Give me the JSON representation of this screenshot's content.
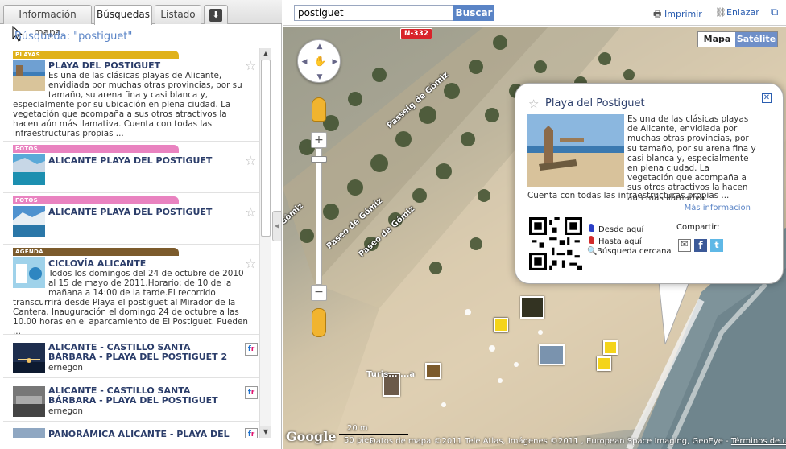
{
  "tabs": {
    "info": "Información mapa",
    "search": "Búsquedas",
    "list": "Listado"
  },
  "search_title": "Búsqueda: \"postiguet\"",
  "results": [
    {
      "category": "PLAYAS",
      "category_color": "#e0b21b",
      "title": "PLAYA DEL POSTIGUET",
      "desc": "Es una de las clásicas playas de Alicante, envidiada por muchas otras provincias, por su tamaño, su arena fina y casi blanca y,",
      "desc_full": "especialmente por su ubicación en plena ciudad. La vegetación que acompaña a sus otros atractivos la hacen aún más llamativa. Cuenta con todas las infraestructuras propias ..."
    },
    {
      "category": "FOTOS",
      "category_color": "#e983c0",
      "title": "ALICANTE PLAYA DEL POSTIGUET"
    },
    {
      "category": "FOTOS",
      "category_color": "#e983c0",
      "title": "ALICANTE PLAYA DEL POSTIGUET"
    },
    {
      "category": "AGENDA",
      "category_color": "#7c5b2c",
      "title": "CICLOVÍA ALICANTE",
      "desc": "Todos los domingos del 24 de octubre de 2010 al 15 de mayo de 2011.Horario: de 10 de la mañana a 14:00 de la tarde.El recorrido",
      "desc_full": "transcurrirá desde Playa el postiguet al Mirador de la Cantera. Inauguración el domingo 24 de octubre a las 10.00 horas en el aparcamiento de El Postiguet. Pueden ..."
    },
    {
      "title": "ALICANTE - CASTILLO SANTA BÁRBARA - PLAYA DEL POSTIGUET 2",
      "author": "ernegon",
      "source_icon": "fr"
    },
    {
      "title": "ALICANTE - CASTILLO SANTA BÁRBARA - PLAYA DEL POSTIGUET",
      "author": "ernegon",
      "source_icon": "fr"
    },
    {
      "title": "PANORÁMICA ALICANTE - PLAYA DEL"
    }
  ],
  "topbar": {
    "search_value": "postiguet",
    "search_button": "Buscar",
    "print": "Imprimir",
    "link": "Enlazar"
  },
  "map": {
    "type_map": "Mapa",
    "type_satellite": "Satélite",
    "road_shield": "N-332",
    "streets": [
      "Passeig de Gòmiz",
      "Paseo de Gómiz",
      "Paseo de Gómiz",
      "Gòmiz"
    ],
    "place_label": "Turis... ...a",
    "google": "Google",
    "scale_1": "20 m",
    "scale_2": "50 pies",
    "attribution": "Datos de mapa ©2011 Tele Atlas, Imágenes ©2011 , European Space Imaging, GeoEye -",
    "terms": "Términos de uso"
  },
  "infowindow": {
    "title": "Playa del Postiguet",
    "desc": "Es una de las clásicas playas de Alicante, envidiada por muchas otras provincias, por su tamaño, por su arena fina y casi blanca y, especialmente en plena ciudad. La vegetación que acompaña a sus otros atractivos la hacen aún más llamativa.",
    "desc_tail": "Cuenta con todas las infraestructuras propias ...",
    "more": "Más información",
    "directions_from": "Desde aquí",
    "directions_to": "Hasta aquí",
    "nearby": "Búsqueda cercana",
    "share_label": "Compartir:"
  }
}
